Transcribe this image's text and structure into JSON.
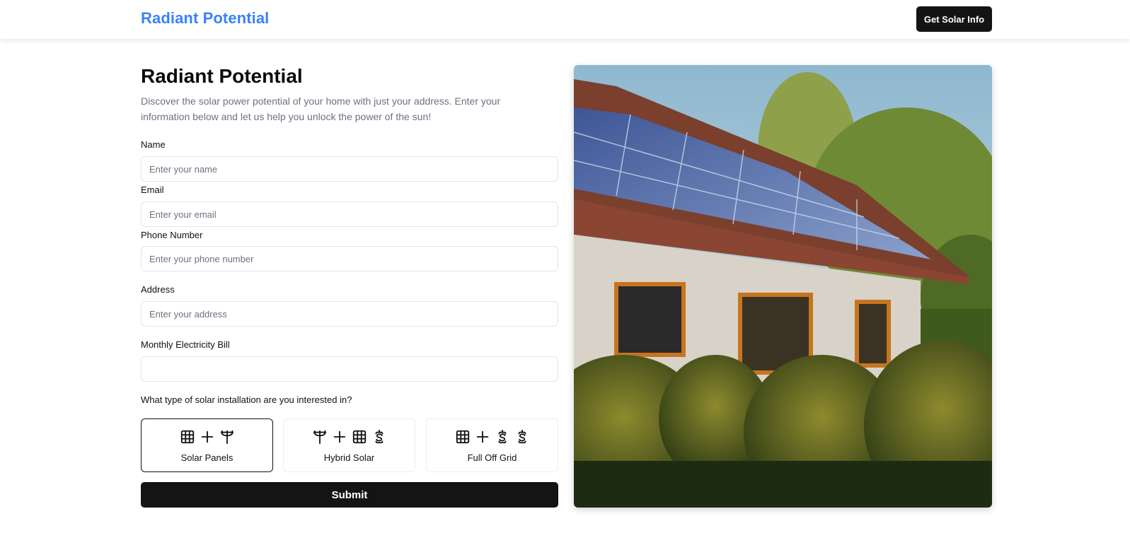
{
  "nav": {
    "brand": "Radiant Potential",
    "cta_label": "Get Solar Info"
  },
  "hero": {
    "title": "Radiant Potential",
    "description": "Discover the solar power potential of your home with just your address. Enter your information below and let us help you unlock the power of the sun!"
  },
  "form": {
    "name": {
      "label": "Name",
      "placeholder": "Enter your name",
      "value": ""
    },
    "email": {
      "label": "Email",
      "placeholder": "Enter your email",
      "value": ""
    },
    "phone": {
      "label": "Phone Number",
      "placeholder": "Enter your phone number",
      "value": ""
    },
    "address": {
      "label": "Address",
      "placeholder": "Enter your address",
      "value": ""
    },
    "bill": {
      "label": "Monthly Electricity Bill",
      "placeholder": "",
      "value": ""
    },
    "installation_question": "What type of solar installation are you interested in?",
    "options": [
      {
        "label": "Solar Panels",
        "icons": [
          "grid-icon",
          "plus-icon",
          "utility-pole-icon"
        ],
        "selected": true
      },
      {
        "label": "Hybrid Solar",
        "icons": [
          "utility-pole-icon",
          "plus-icon",
          "grid-icon",
          "battery-icon"
        ],
        "selected": false
      },
      {
        "label": "Full Off Grid",
        "icons": [
          "grid-icon",
          "plus-icon",
          "battery-icon",
          "battery-icon"
        ],
        "selected": false
      }
    ],
    "submit_label": "Submit"
  },
  "image": {
    "icon": "house-with-solar-panels-photo"
  },
  "colors": {
    "brand": "#3b82f6",
    "button_bg": "#141414",
    "muted_text": "#6b7280",
    "input_border": "#e2e4e8"
  }
}
